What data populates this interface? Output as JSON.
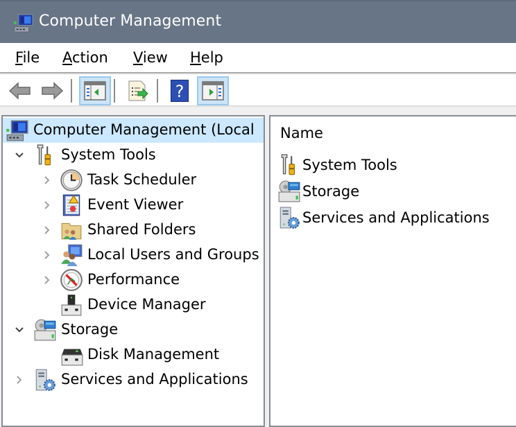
{
  "window": {
    "title": "Computer Management",
    "app_icon": "computer-management-icon"
  },
  "menu": [
    {
      "label": "File",
      "mnemonic": "F",
      "rest": "ile"
    },
    {
      "label": "Action",
      "mnemonic": "A",
      "rest": "ction"
    },
    {
      "label": "View",
      "mnemonic": "V",
      "rest": "iew"
    },
    {
      "label": "Help",
      "mnemonic": "H",
      "rest": "elp"
    }
  ],
  "toolbar": {
    "buttons": [
      {
        "name": "back",
        "icon": "arrow-left-icon",
        "active": false,
        "enabled": false
      },
      {
        "name": "forward",
        "icon": "arrow-right-icon",
        "active": false,
        "enabled": false
      },
      {
        "name": "show-hide-console-tree",
        "icon": "console-tree-icon",
        "active": true
      },
      {
        "name": "export-list",
        "icon": "export-list-icon",
        "active": false
      },
      {
        "name": "help",
        "icon": "help-icon",
        "active": false
      },
      {
        "name": "show-hide-action-pane",
        "icon": "action-pane-icon",
        "active": true
      }
    ]
  },
  "tree": {
    "items": [
      {
        "label": "Computer Management (Local",
        "icon": "computer-management-icon",
        "level": 0,
        "expander": "none",
        "selected": true
      },
      {
        "label": "System Tools",
        "icon": "system-tools-icon",
        "level": 1,
        "expander": "expanded"
      },
      {
        "label": "Task Scheduler",
        "icon": "clock-icon",
        "level": 2,
        "expander": "collapsed"
      },
      {
        "label": "Event Viewer",
        "icon": "event-viewer-icon",
        "level": 2,
        "expander": "collapsed"
      },
      {
        "label": "Shared Folders",
        "icon": "shared-folder-icon",
        "level": 2,
        "expander": "collapsed"
      },
      {
        "label": "Local Users and Groups",
        "icon": "users-icon",
        "level": 2,
        "expander": "collapsed"
      },
      {
        "label": "Performance",
        "icon": "performance-icon",
        "level": 2,
        "expander": "collapsed"
      },
      {
        "label": "Device Manager",
        "icon": "device-manager-icon",
        "level": 2,
        "expander": "none"
      },
      {
        "label": "Storage",
        "icon": "storage-icon",
        "level": 1,
        "expander": "expanded"
      },
      {
        "label": "Disk Management",
        "icon": "disk-icon",
        "level": 2,
        "expander": "none"
      },
      {
        "label": "Services and Applications",
        "icon": "services-icon",
        "level": 1,
        "expander": "collapsed"
      }
    ]
  },
  "list": {
    "column_header": "Name",
    "items": [
      {
        "label": "System Tools",
        "icon": "system-tools-icon"
      },
      {
        "label": "Storage",
        "icon": "storage-icon"
      },
      {
        "label": "Services and Applications",
        "icon": "services-icon"
      }
    ]
  }
}
